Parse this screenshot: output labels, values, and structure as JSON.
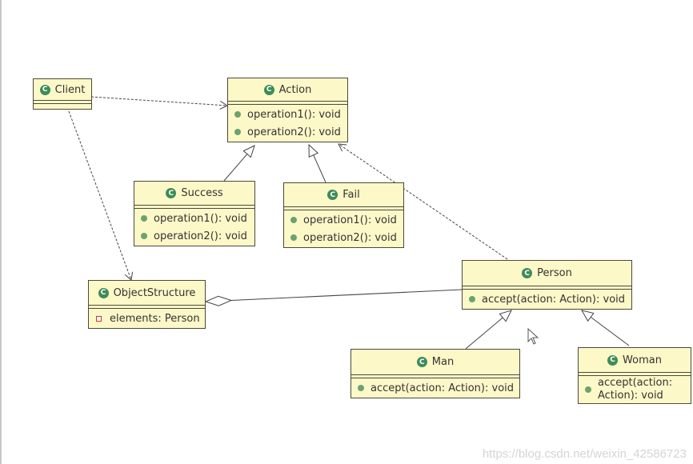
{
  "classes": [
    {
      "id": "client",
      "name": "Client",
      "members": []
    },
    {
      "id": "action",
      "name": "Action",
      "members": [
        {
          "kind": "method",
          "text": "operation1(): void"
        },
        {
          "kind": "method",
          "text": "operation2(): void"
        }
      ]
    },
    {
      "id": "success",
      "name": "Success",
      "members": [
        {
          "kind": "method",
          "text": "operation1(): void"
        },
        {
          "kind": "method",
          "text": "operation2(): void"
        }
      ]
    },
    {
      "id": "fail",
      "name": "Fail",
      "members": [
        {
          "kind": "method",
          "text": "operation1(): void"
        },
        {
          "kind": "method",
          "text": "operation2(): void"
        }
      ]
    },
    {
      "id": "objectstructure",
      "name": "ObjectStructure",
      "members": [
        {
          "kind": "field",
          "text": "elements: Person"
        }
      ]
    },
    {
      "id": "person",
      "name": "Person",
      "members": [
        {
          "kind": "method",
          "text": "accept(action: Action): void"
        }
      ]
    },
    {
      "id": "man",
      "name": "Man",
      "members": [
        {
          "kind": "method",
          "text": "accept(action: Action): void"
        }
      ]
    },
    {
      "id": "woman",
      "name": "Woman",
      "members": [
        {
          "kind": "method",
          "text": "accept(action: Action): void"
        }
      ]
    }
  ],
  "relations": [
    {
      "from": "client",
      "to": "action",
      "type": "dependency"
    },
    {
      "from": "client",
      "to": "objectstructure",
      "type": "dependency"
    },
    {
      "from": "success",
      "to": "action",
      "type": "generalization"
    },
    {
      "from": "fail",
      "to": "action",
      "type": "generalization"
    },
    {
      "from": "person",
      "to": "action",
      "type": "dependency"
    },
    {
      "from": "objectstructure",
      "to": "person",
      "type": "aggregation"
    },
    {
      "from": "man",
      "to": "person",
      "type": "generalization"
    },
    {
      "from": "woman",
      "to": "person",
      "type": "generalization"
    }
  ],
  "class_icon_letter": "C",
  "watermark": "https://blog.csdn.net/weixin_42586723",
  "colors": {
    "class_fill": "#fdf8c8",
    "class_icon": "#3d8c5a",
    "method_dot": "#6aa36e",
    "field_marker": "#cc3333"
  }
}
